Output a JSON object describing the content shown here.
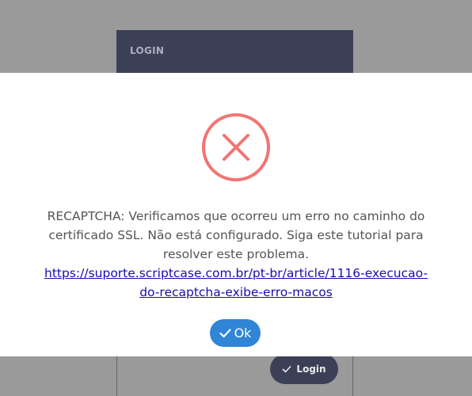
{
  "background": {
    "login_title": "LOGIN",
    "login_button_label": "Login"
  },
  "modal": {
    "icon": "error-x-icon",
    "message_line1": "RECAPTCHA: Verificamos que ocorreu um erro no caminho do",
    "message_line2": "certificado SSL. Não está configurado. Siga este tutorial para",
    "message_line3": "resolver este problema.",
    "link_line1": "https://suporte.scriptcase.com.br/pt-br/article/1116-execucao-",
    "link_line2": "do-recaptcha-exibe-erro-macos",
    "ok_label": "Ok",
    "colors": {
      "error": "#f27474",
      "confirm": "#3085d6",
      "link": "#1a0dab"
    }
  }
}
